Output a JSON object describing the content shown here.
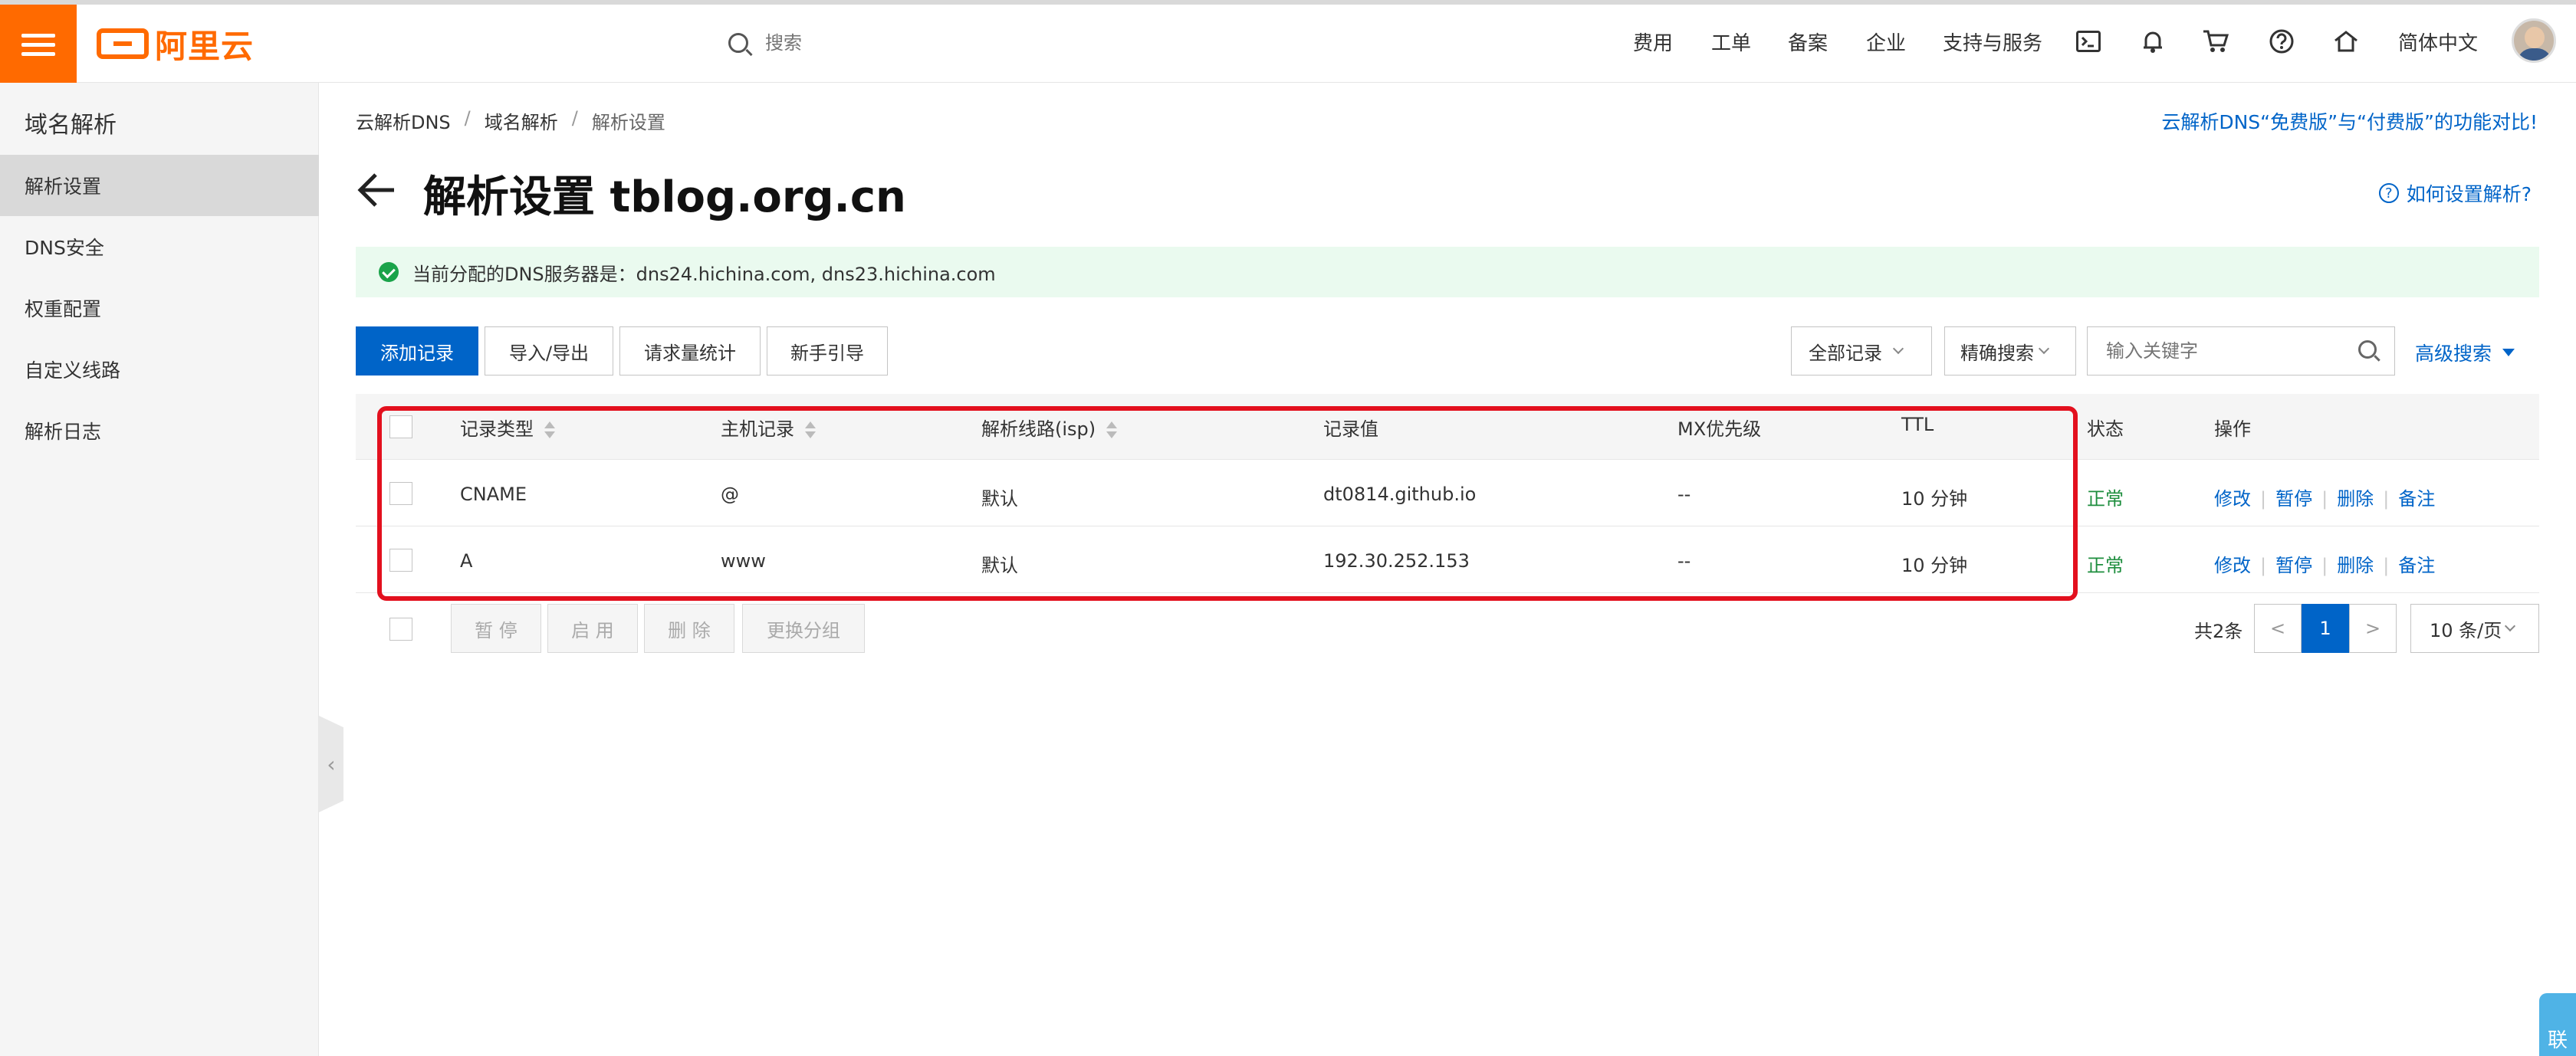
{
  "topbar": {
    "logo_text": "阿里云",
    "search_placeholder": "搜索",
    "nav": [
      "费用",
      "工单",
      "备案",
      "企业",
      "支持与服务"
    ],
    "language": "简体中文",
    "icons": [
      "terminal-icon",
      "bell-icon",
      "cart-icon",
      "help-icon",
      "home-icon"
    ]
  },
  "sidebar": {
    "title": "域名解析",
    "items": [
      "解析设置",
      "DNS安全",
      "权重配置",
      "自定义线路",
      "解析日志"
    ],
    "active_index": 0
  },
  "breadcrumb": [
    "云解析DNS",
    "域名解析",
    "解析设置"
  ],
  "compare_link": "云解析DNS“免费版”与“付费版”的功能对比!",
  "page_title": "解析设置 tblog.org.cn",
  "howto_link": "如何设置解析?",
  "notice": "当前分配的DNS服务器是：dns24.hichina.com, dns23.hichina.com",
  "toolbar": {
    "add": "添加记录",
    "import_export": "导入/导出",
    "stats": "请求量统计",
    "guide": "新手引导",
    "filter_all": "全部记录",
    "exact_search": "精确搜索",
    "keyword_placeholder": "输入关键字",
    "advanced": "高级搜索"
  },
  "table": {
    "headers": [
      "记录类型",
      "主机记录",
      "解析线路(isp)",
      "记录值",
      "MX优先级",
      "TTL",
      "状态",
      "操作"
    ],
    "rows": [
      {
        "type": "CNAME",
        "host": "@",
        "line": "默认",
        "value": "dt0814.github.io",
        "mx": "--",
        "ttl": "10 分钟",
        "status": "正常"
      },
      {
        "type": "A",
        "host": "www",
        "line": "默认",
        "value": "192.30.252.153",
        "mx": "--",
        "ttl": "10 分钟",
        "status": "正常"
      }
    ],
    "ops": [
      "修改",
      "暂停",
      "删除",
      "备注"
    ]
  },
  "bulk": [
    "暂 停",
    "启 用",
    "删 除",
    "更换分组"
  ],
  "pagination": {
    "total": "共2条",
    "prev": "<",
    "current": "1",
    "next": ">",
    "page_size": "10 条/页"
  },
  "contact_widget": "联",
  "colors": {
    "accent": "#ff6a00",
    "primary": "#0064c8",
    "success": "#1e8e3e",
    "highlight": "#e3101e"
  }
}
